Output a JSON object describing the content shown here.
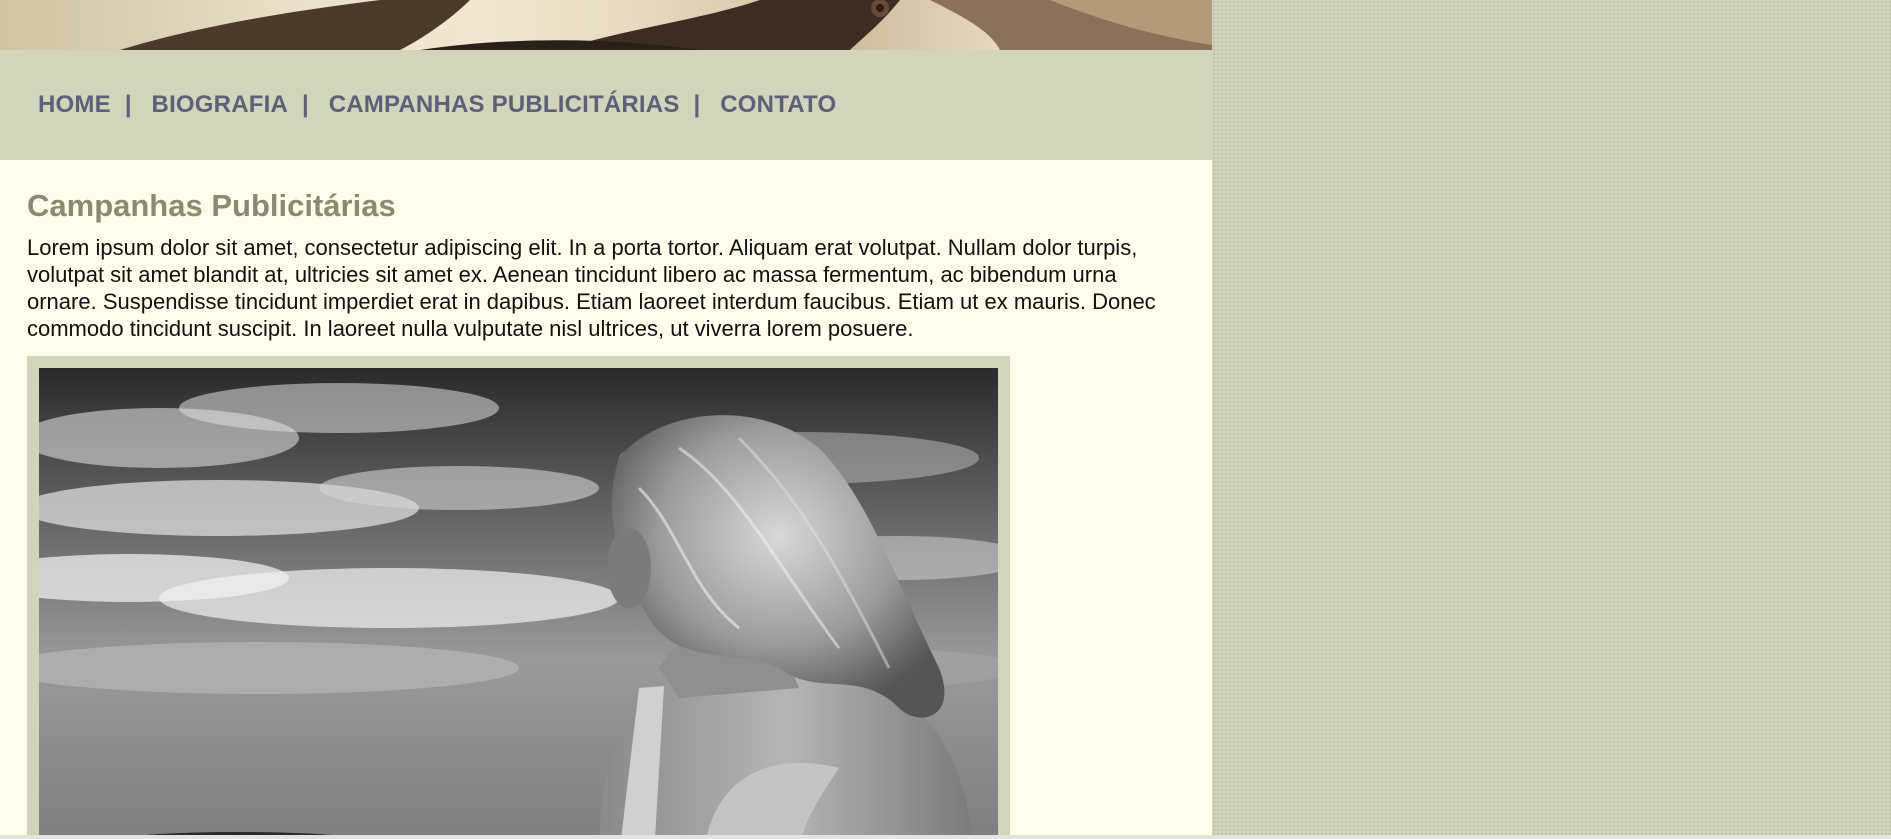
{
  "nav": {
    "items": [
      {
        "label": "HOME"
      },
      {
        "label": "BIOGRAFIA"
      },
      {
        "label": "CAMPANHAS PUBLICITÁRIAS"
      },
      {
        "label": "CONTATO"
      }
    ],
    "separator": "|"
  },
  "main": {
    "title": "Campanhas Publicitárias",
    "body": "Lorem ipsum dolor sit amet, consectetur adipiscing elit. In a porta tortor. Aliquam erat volutpat. Nullam dolor turpis, volutpat sit amet blandit at, ultricies sit amet ex. Aenean tincidunt libero ac massa fermentum, ac bibendum urna ornare. Suspendisse tincidunt imperdiet erat in dapibus. Etiam laoreet interdum faucibus. Etiam ut ex mauris. Donec commodo tincidunt suscipit. In laoreet nulla vulputate nisl ultrices, ut viverra lorem posuere."
  },
  "colors": {
    "background": "#d0d2bd",
    "page": "#fefdec",
    "nav_bar": "#d3d4bc",
    "nav_text": "#5c6177",
    "heading": "#8a8a70"
  }
}
